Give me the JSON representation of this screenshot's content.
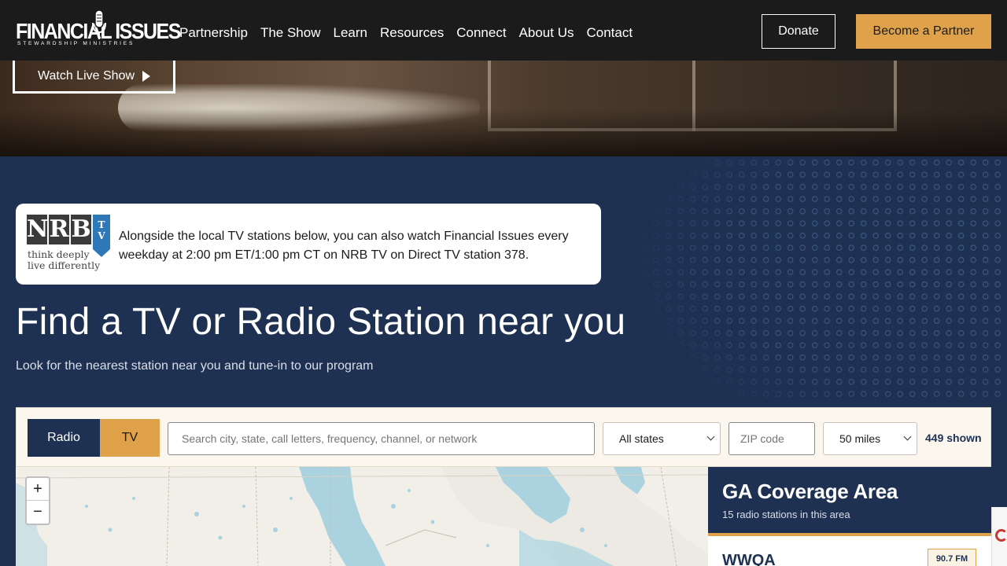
{
  "header": {
    "logo_main": "FINANCIAL ISSUES",
    "logo_sub": "STEWARDSHIP MINISTRIES",
    "nav": [
      "Partnership",
      "The Show",
      "Learn",
      "Resources",
      "Connect",
      "About Us",
      "Contact"
    ],
    "donate_label": "Donate",
    "partner_label": "Become a Partner"
  },
  "hero": {
    "watch_label": "Watch Live Show"
  },
  "nrb": {
    "letters": [
      "N",
      "R",
      "B"
    ],
    "tv": "TV",
    "tagline_1": "think deeply",
    "tagline_2": "live differently",
    "text": "Alongside the local TV stations below, you can also watch Financial Issues every weekday at 2:00 pm ET/1:00 pm CT on NRB TV on Direct TV station 378."
  },
  "main": {
    "heading": "Find a TV or Radio Station near you",
    "subheading": "Look for the nearest station near you and tune-in to our program"
  },
  "finder": {
    "tab_radio": "Radio",
    "tab_tv": "TV",
    "search_placeholder": "Search city, state, call letters, frequency, channel, or network",
    "states_value": "All states",
    "zip_placeholder": "ZIP code",
    "miles_value": "50 miles",
    "shown": "449 shown",
    "zoom_in": "+",
    "zoom_out": "−"
  },
  "coverage": {
    "title": "GA Coverage Area",
    "subtitle": "15 radio stations in this area",
    "first_station": "WWQA",
    "first_freq": "90.7 FM"
  },
  "colors": {
    "navy": "#1e3152",
    "gold": "#dfa24a",
    "header": "#1b1b1b"
  },
  "icons": [
    "microphone-icon",
    "play-icon",
    "chevron-down-icon",
    "recaptcha-icon"
  ]
}
